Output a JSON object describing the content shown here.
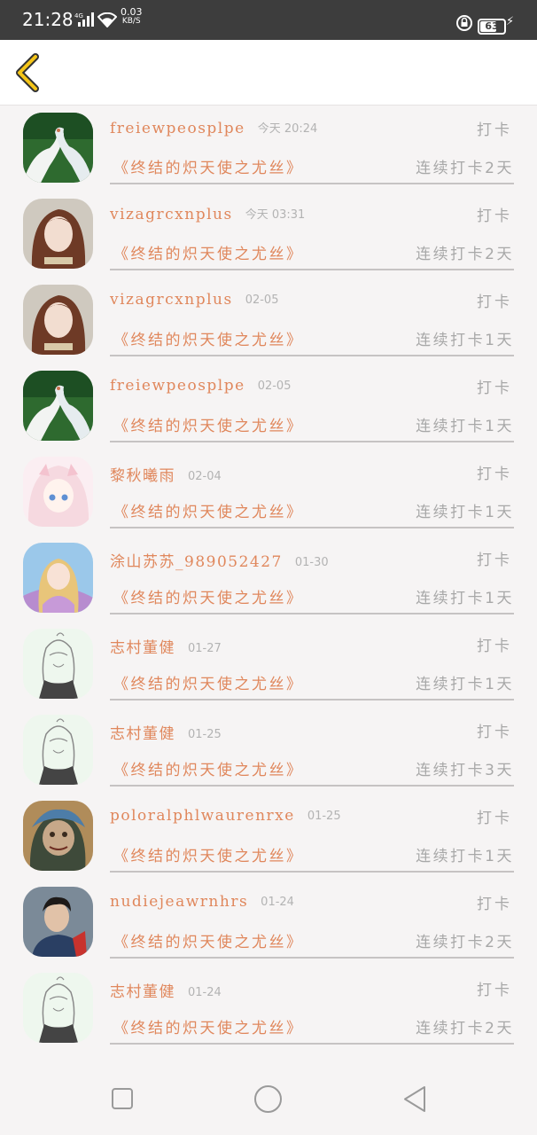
{
  "status_bar": {
    "time": "21:28",
    "network": "4G",
    "speed_value": "0.03",
    "speed_unit": "KB/S",
    "battery": "63"
  },
  "header": {
    "back_icon": "chevron-left-icon",
    "accent_color": "#f5c518"
  },
  "colors": {
    "name": "#e0875c",
    "muted": "#a8a8a8",
    "background": "#f6f4f4"
  },
  "checkins": [
    {
      "avatar": "doves-avatar",
      "name": "freiewpeosplpe",
      "date": "今天 20:24",
      "action": "打卡",
      "book": "《终结的炽天使之尤丝》",
      "streak": "连续打卡2天"
    },
    {
      "avatar": "girl-avatar",
      "name": "vizagrcxnplus",
      "date": "今天 03:31",
      "action": "打卡",
      "book": "《终结的炽天使之尤丝》",
      "streak": "连续打卡2天"
    },
    {
      "avatar": "girl-avatar",
      "name": "vizagrcxnplus",
      "date": "02-05",
      "action": "打卡",
      "book": "《终结的炽天使之尤丝》",
      "streak": "连续打卡1天"
    },
    {
      "avatar": "doves-avatar",
      "name": "freiewpeosplpe",
      "date": "02-05",
      "action": "打卡",
      "book": "《终结的炽天使之尤丝》",
      "streak": "连续打卡1天"
    },
    {
      "avatar": "anime-pink-avatar",
      "name": "黎秋曦雨",
      "date": "02-04",
      "action": "打卡",
      "book": "《终结的炽天使之尤丝》",
      "streak": "连续打卡1天"
    },
    {
      "avatar": "anime-purple-avatar",
      "name": "涂山苏苏_989052427",
      "date": "01-30",
      "action": "打卡",
      "book": "《终结的炽天使之尤丝》",
      "streak": "连续打卡1天"
    },
    {
      "avatar": "sketch-avatar",
      "name": "志村董健",
      "date": "01-27",
      "action": "打卡",
      "book": "《终结的炽天使之尤丝》",
      "streak": "连续打卡1天"
    },
    {
      "avatar": "sketch-avatar",
      "name": "志村董健",
      "date": "01-25",
      "action": "打卡",
      "book": "《终结的炽天使之尤丝》",
      "streak": "连续打卡3天"
    },
    {
      "avatar": "jinx-avatar",
      "name": "poloralphlwaurenrxe",
      "date": "01-25",
      "action": "打卡",
      "book": "《终结的炽天使之尤丝》",
      "streak": "连续打卡1天"
    },
    {
      "avatar": "man-avatar",
      "name": "nudiejeawrnhrs",
      "date": "01-24",
      "action": "打卡",
      "book": "《终结的炽天使之尤丝》",
      "streak": "连续打卡2天"
    },
    {
      "avatar": "sketch-avatar",
      "name": "志村董健",
      "date": "01-24",
      "action": "打卡",
      "book": "《终结的炽天使之尤丝》",
      "streak": "连续打卡2天"
    }
  ],
  "nav_bar": {
    "recents_icon": "square-icon",
    "home_icon": "circle-icon",
    "back_icon": "triangle-back-icon"
  }
}
